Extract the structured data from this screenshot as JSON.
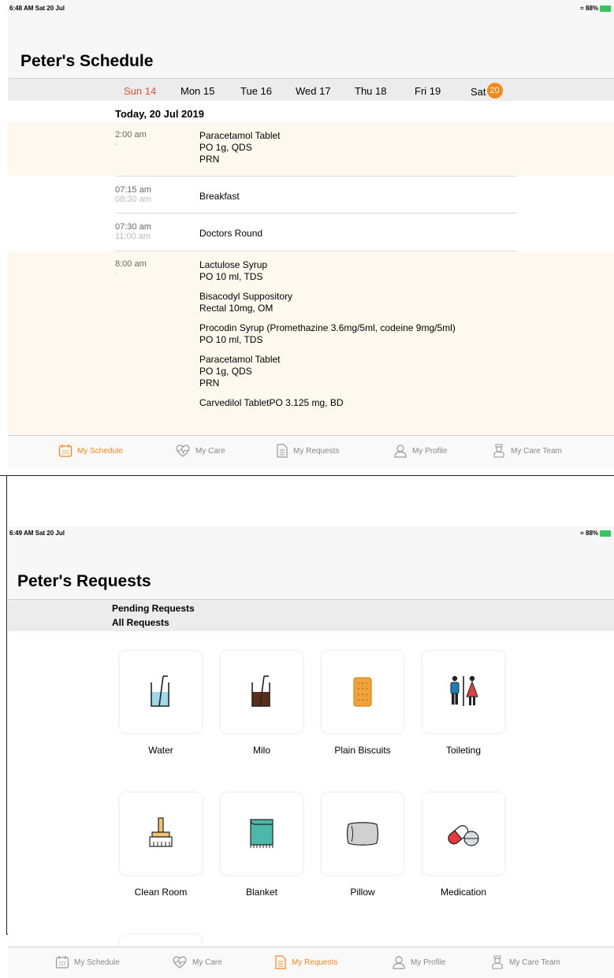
{
  "schedule": {
    "status_time": "6:48 AM  Sat 20 Jul",
    "status_right": "≈ 88%",
    "title": "Peter's Schedule",
    "days": [
      "Sun 14",
      "Mon 15",
      "Tue 16",
      "Wed 17",
      "Thu 18",
      "Fri 19",
      "Sat"
    ],
    "today_number": "20",
    "date_header": "Today, 20 Jul 2019",
    "entries": [
      {
        "time": "2:00 am",
        "end": "-",
        "lines": [
          "Paracetamol Tablet",
          "PO 1g, QDS",
          "PRN"
        ]
      },
      {
        "time": "07:15 am",
        "end": "08:30 am",
        "lines": [
          "Breakfast"
        ]
      },
      {
        "time": "07:30 am",
        "end": "11:00 am",
        "lines": [
          "Doctors Round"
        ]
      },
      {
        "time": "8:00 am",
        "end": "-",
        "groups": [
          [
            "Lactulose Syrup",
            "PO 10 ml, TDS"
          ],
          [
            "Bisacodyl Suppository",
            "Rectal 10mg, OM"
          ],
          [
            "Procodin Syrup (Promethazine 3.6mg/5ml, codeine 9mg/5ml)",
            "PO 10 ml, TDS"
          ],
          [
            "Paracetamol Tablet",
            "PO 1g, QDS",
            "PRN"
          ],
          [
            "Carvedilol TabletPO 3.125 mg, BD"
          ]
        ]
      }
    ]
  },
  "requests": {
    "status_time": "6:49 AM  Sat 20 Jul",
    "status_right": "≈ 88%",
    "title": "Peter's Requests",
    "filters": [
      "Pending Requests",
      "All Requests"
    ],
    "items": [
      "Water",
      "Milo",
      "Plain Biscuits",
      "Toileting",
      "Clean Room",
      "Blanket",
      "Pillow",
      "Medication"
    ]
  },
  "tabs": [
    "My Schedule",
    "My Care",
    "My Requests",
    "My Profile",
    "My Care Team"
  ],
  "colors": {
    "accent": "#f5891c",
    "today_red": "#e8502d",
    "highlight": "#fdf9ef"
  }
}
